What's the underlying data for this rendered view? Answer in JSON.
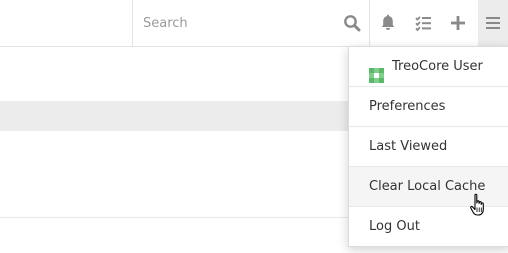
{
  "search": {
    "placeholder": "Search"
  },
  "navbar": {
    "icons": [
      "search-icon",
      "bell-icon",
      "task-list-icon",
      "plus-icon",
      "hamburger-menu-icon"
    ]
  },
  "dropdown": {
    "user_name": "TreoCore User",
    "items": [
      {
        "label": "Preferences"
      },
      {
        "label": "Last Viewed"
      },
      {
        "label": "Clear Local Cache"
      },
      {
        "label": "Log Out"
      }
    ]
  },
  "colors": {
    "icon": "#8a8a8a",
    "avatar": "#7fcf8a",
    "text": "#333333",
    "hover_bg": "#f5f5f5",
    "band_bg": "#ececec"
  }
}
